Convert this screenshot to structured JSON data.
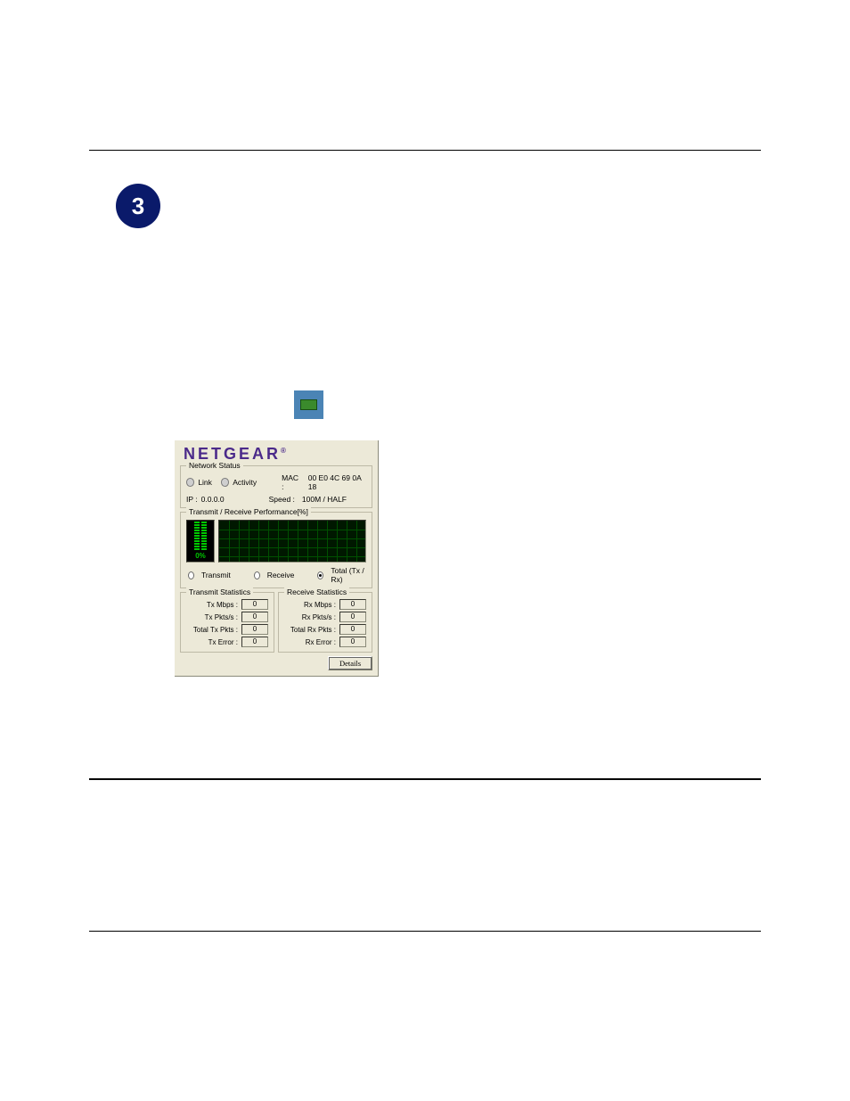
{
  "step_number": "3",
  "panel": {
    "logo_text": "NETGEAR",
    "logo_mark": "®",
    "network_status": {
      "title": "Network Status",
      "link_label": "Link",
      "activity_label": "Activity",
      "mac_label": "MAC :",
      "mac_value": "00 E0 4C 69 0A 18",
      "ip_label": "IP :",
      "ip_value": "0.0.0.0",
      "speed_label": "Speed :",
      "speed_value": "100M / HALF"
    },
    "performance": {
      "title": "Transmit / Receive Performance[%]",
      "meter_pct": "0%",
      "radios": {
        "transmit": "Transmit",
        "receive": "Receive",
        "total": "Total (Tx / Rx)",
        "selected": "total"
      }
    },
    "tx_stats": {
      "title": "Transmit Statistics",
      "rows": [
        {
          "label": "Tx Mbps :",
          "value": "0"
        },
        {
          "label": "Tx Pkts/s :",
          "value": "0"
        },
        {
          "label": "Total Tx Pkts :",
          "value": "0"
        },
        {
          "label": "Tx Error :",
          "value": "0"
        }
      ]
    },
    "rx_stats": {
      "title": "Receive Statistics",
      "rows": [
        {
          "label": "Rx Mbps :",
          "value": "0"
        },
        {
          "label": "Rx Pkts/s :",
          "value": "0"
        },
        {
          "label": "Total Rx Pkts :",
          "value": "0"
        },
        {
          "label": "Rx Error :",
          "value": "0"
        }
      ]
    },
    "details_button": "Details"
  }
}
